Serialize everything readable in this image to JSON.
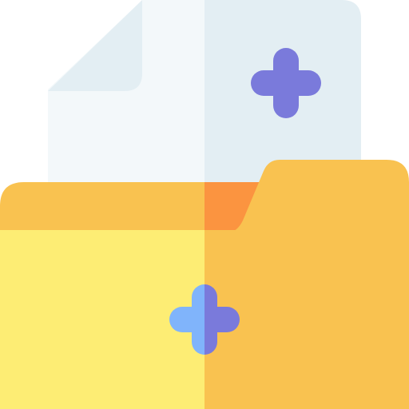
{
  "icon": {
    "name": "add-file-to-folder-icon",
    "colors": {
      "document_left": "#f3f8fa",
      "document_right": "#e3eef3",
      "document_fold": "#e3eef3",
      "document_plus": "#7a7adb",
      "folder_back_tab": "#f9c250",
      "folder_tab_shadow": "#fb9440",
      "folder_front_left": "#fded74",
      "folder_front_right": "#f9c250",
      "folder_plus_left": "#80b4fb",
      "folder_plus_right": "#7a7adb"
    }
  }
}
